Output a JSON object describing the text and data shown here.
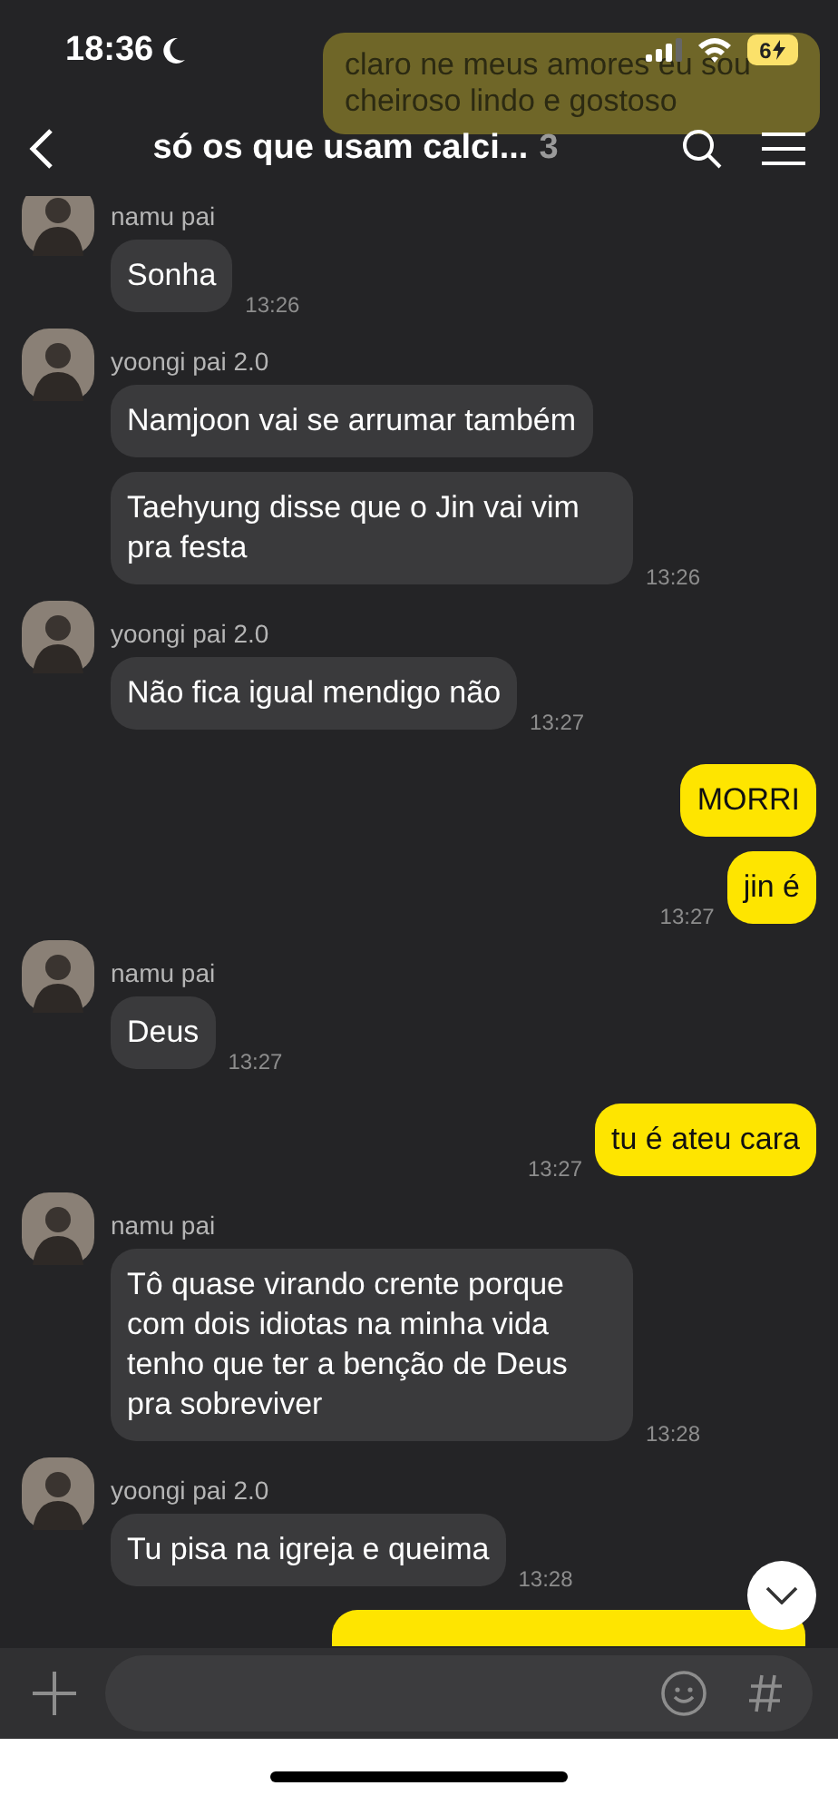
{
  "status_bar": {
    "time": "18:36",
    "battery": "6"
  },
  "preview": {
    "text": "claro ne meus amores eu sou cheiroso lindo e gostoso"
  },
  "header": {
    "title": "só os que usam calci...",
    "count": "3"
  },
  "messages": [
    {
      "kind": "received",
      "sender": "namu pai",
      "bubbles": [
        "Sonha"
      ],
      "time": "13:26"
    },
    {
      "kind": "received",
      "sender": "yoongi pai 2.0",
      "bubbles": [
        "Namjoon vai se arrumar também",
        "Taehyung disse que o Jin vai vim pra festa"
      ],
      "time": "13:26"
    },
    {
      "kind": "received",
      "sender": "yoongi pai 2.0",
      "bubbles": [
        "Não fica igual mendigo não"
      ],
      "time": "13:27"
    },
    {
      "kind": "sent",
      "bubbles": [
        "MORRI",
        "jin é"
      ],
      "time": "13:27"
    },
    {
      "kind": "received",
      "sender": "namu pai",
      "bubbles": [
        "Deus"
      ],
      "time": "13:27"
    },
    {
      "kind": "sent",
      "bubbles": [
        "tu é ateu cara"
      ],
      "time": "13:27"
    },
    {
      "kind": "received",
      "sender": "namu pai",
      "bubbles": [
        "Tô quase virando crente porque com dois idiotas na minha vida tenho que ter a benção de Deus pra sobreviver"
      ],
      "time": "13:28"
    },
    {
      "kind": "received",
      "sender": "yoongi pai 2.0",
      "bubbles": [
        "Tu pisa na igreja e queima"
      ],
      "time": "13:28"
    },
    {
      "kind": "partial"
    }
  ]
}
